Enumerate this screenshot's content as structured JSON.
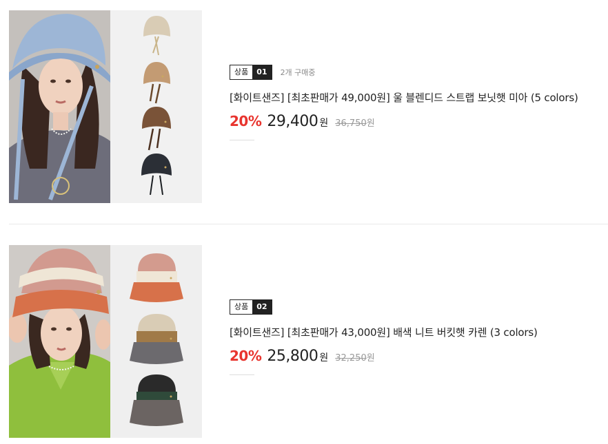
{
  "products": [
    {
      "badge_label": "상품",
      "badge_number": "01",
      "buying_count": "2개 구매중",
      "title": "[화이트샌즈] [최초판매가 49,000원] 울 블렌디드 스트랩 보닛햇 미아 (5 colors)",
      "discount": "20%",
      "price": "29,400",
      "currency": "원",
      "original_price": "36,750",
      "original_currency": "원",
      "colors": {
        "model_hat": "#9db6d6",
        "swatches": [
          "#d9ccb5",
          "#c39b73",
          "#7a5338",
          "#2b2f36"
        ]
      }
    },
    {
      "badge_label": "상품",
      "badge_number": "02",
      "title": "[화이트샌즈] [최초판매가 43,000원] 배색 니트 버킷햇 카렌 (3 colors)",
      "discount": "20%",
      "price": "25,800",
      "currency": "원",
      "original_price": "32,250",
      "original_currency": "원",
      "colors": {
        "model_hat": "#d7714a",
        "swatches": [
          "#d39b8e",
          "#a07a48",
          "#2a2a2a"
        ]
      }
    }
  ]
}
